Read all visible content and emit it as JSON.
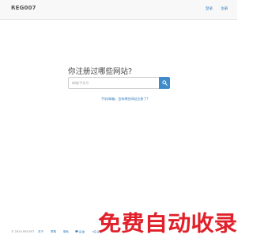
{
  "header": {
    "brand": "REG007",
    "login": "登录",
    "register": "注册"
  },
  "main": {
    "headline": "你注册过哪些网站?",
    "search_placeholder": "邮箱/手机号",
    "hint_link": "手机/邮箱，会有哪些网站注册了?"
  },
  "footer": {
    "copyright": "© 2024 REG007",
    "about": "关于",
    "help": "帮助",
    "privacy": "隐私",
    "feedback": "反馈",
    "share": "分享"
  },
  "watermark": {
    "text": "免费自动收录",
    "color": "#e0202a"
  },
  "colors": {
    "accent": "#428bca",
    "link": "#337ab7"
  },
  "icons": {
    "search_button": "search-icon",
    "feedback": "comment-icon",
    "share": "share-icon"
  }
}
